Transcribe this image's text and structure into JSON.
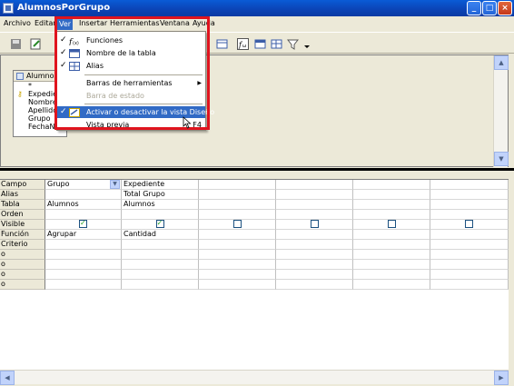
{
  "window": {
    "title": "AlumnosPorGrupo"
  },
  "menubar": {
    "items": [
      "Archivo",
      "Editar",
      "Ver",
      "Insertar",
      "Herramientas",
      "Ventana",
      "Ayuda"
    ]
  },
  "view_menu": {
    "items": [
      {
        "label": "Funciones",
        "checked": true,
        "icon": "functions-icon"
      },
      {
        "label": "Nombre de la tabla",
        "checked": true,
        "icon": "table-name-icon"
      },
      {
        "label": "Alias",
        "checked": true,
        "icon": "alias-icon"
      },
      {
        "label": "Barras de herramientas",
        "submenu": true
      },
      {
        "label": "Barra de estado",
        "disabled": true
      },
      {
        "label": "Activar o desactivar la vista Diseño",
        "checked": true,
        "highlighted": true,
        "icon": "design-view-icon"
      },
      {
        "label": "Vista previa",
        "shortcut": "F4"
      }
    ]
  },
  "table_box": {
    "title": "Alumnos",
    "fields": [
      "*",
      "Expedient",
      "Nombre",
      "Apellidos",
      "Grupo",
      "FechaNac"
    ]
  },
  "grid": {
    "row_labels": [
      "Campo",
      "Alias",
      "Tabla",
      "Orden",
      "Visible",
      "Función",
      "Criterio",
      "o",
      "o",
      "o",
      "o"
    ],
    "columns": [
      {
        "Campo": "Grupo",
        "Alias": "",
        "Tabla": "Alumnos",
        "Visible": true,
        "Función": "Agrupar"
      },
      {
        "Campo": "Expediente",
        "Alias": "Total Grupo",
        "Tabla": "Alumnos",
        "Visible": true,
        "Función": "Cantidad"
      },
      {
        "Visible": false
      },
      {
        "Visible": false
      },
      {
        "Visible": false
      },
      {
        "Visible": false
      }
    ]
  },
  "colors": {
    "title_bar": "#0b43b5",
    "menu_highlight": "#316ac5",
    "annotation": "#e0141e"
  }
}
